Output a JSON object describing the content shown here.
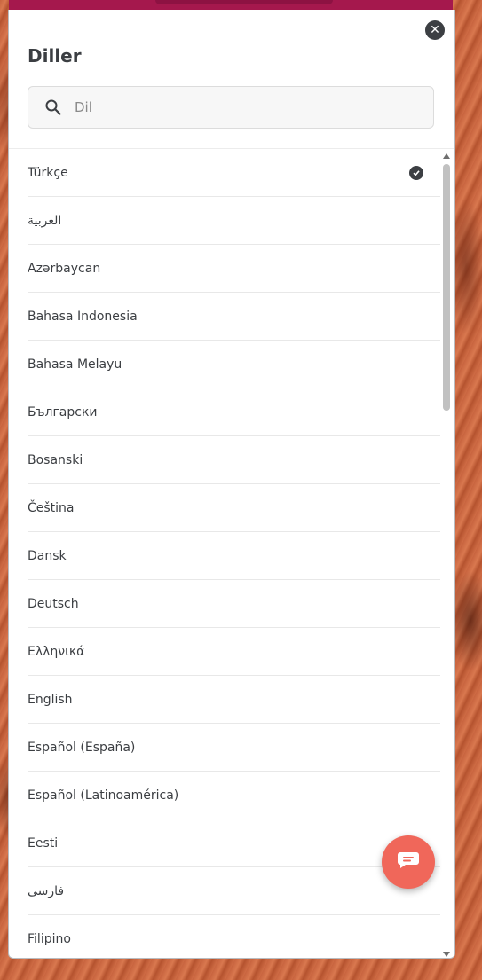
{
  "modal": {
    "title": "Diller",
    "search_placeholder": "Dil",
    "close_icon": "close-icon",
    "selected_language": "Türkçe"
  },
  "languages": [
    "Türkçe",
    "العربية",
    "Azərbaycan",
    "Bahasa Indonesia",
    "Bahasa Melayu",
    "Български",
    "Bosanski",
    "Čeština",
    "Dansk",
    "Deutsch",
    "Ελληνικά",
    "English",
    "Español (España)",
    "Español (Latinoamérica)",
    "Eesti",
    "فارسی",
    "Filipino"
  ],
  "colors": {
    "top_bar": "#a5184d",
    "chat_button": "#f0675a",
    "check": "#3c3f43"
  }
}
